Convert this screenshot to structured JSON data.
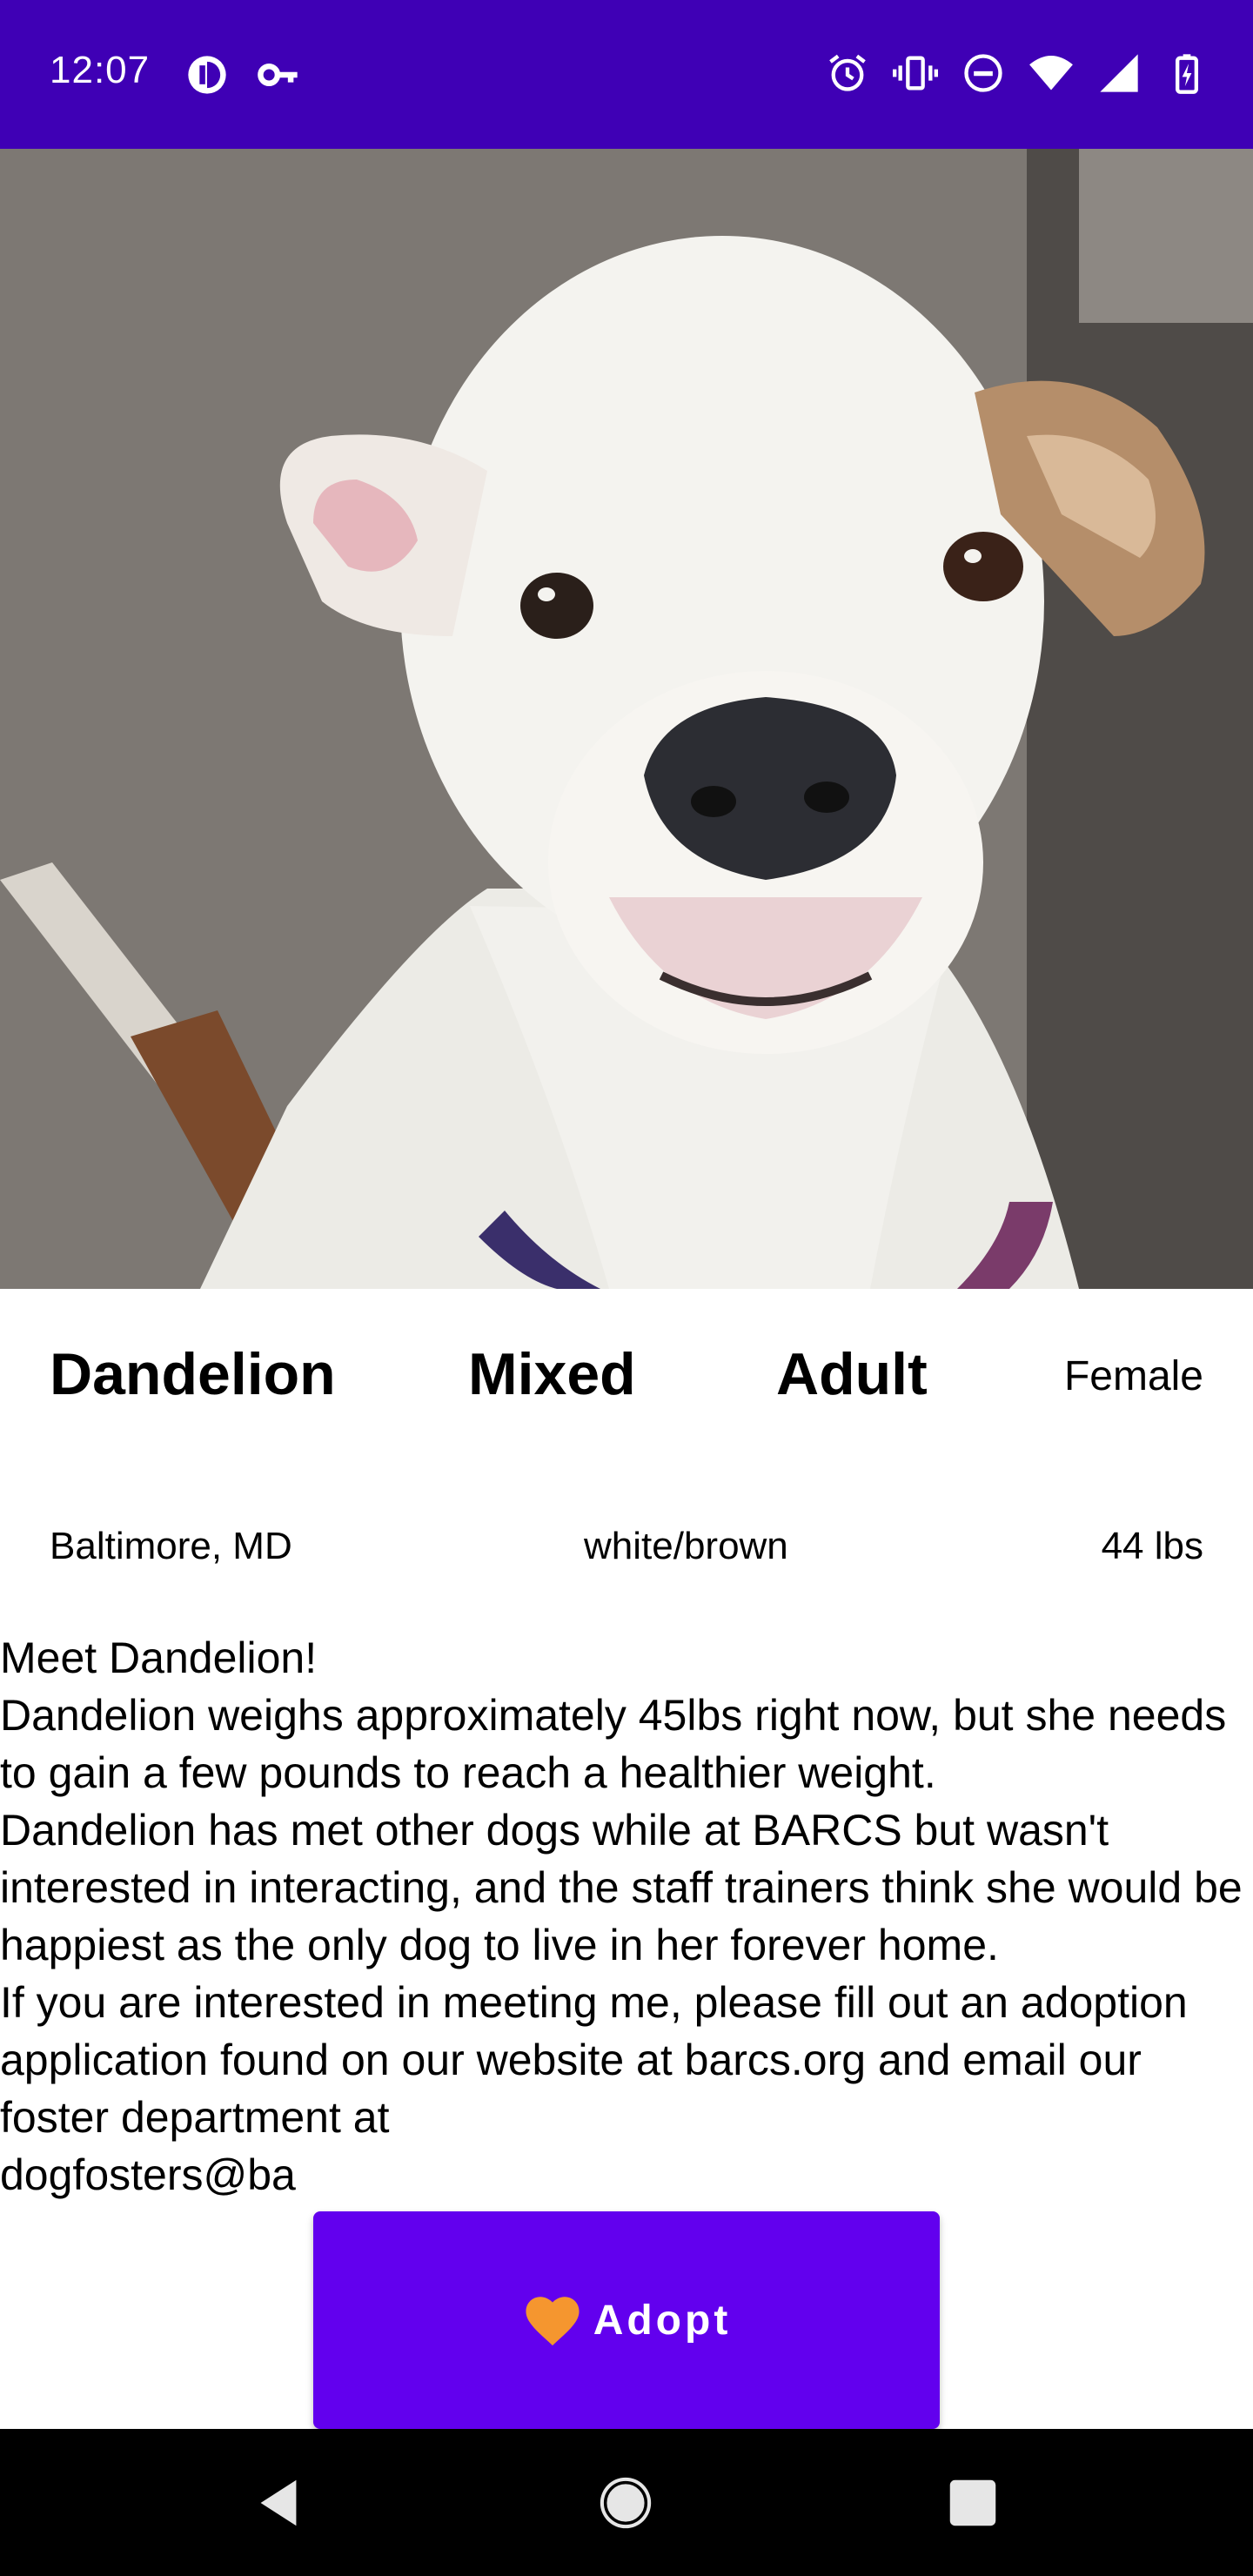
{
  "status_bar": {
    "time": "12:07",
    "icons_left": [
      "data-saver-icon",
      "vpn-key-icon"
    ],
    "icons_right": [
      "alarm-icon",
      "vibrate-icon",
      "do-not-disturb-icon",
      "wifi-icon",
      "cell-signal-icon",
      "battery-charging-icon"
    ]
  },
  "hero": {
    "image": "dog-photo"
  },
  "pet": {
    "name": "Dandelion",
    "breed": "Mixed",
    "age": "Adult",
    "gender": "Female",
    "location": "Baltimore, MD",
    "color": "white/brown",
    "weight": "44 lbs"
  },
  "description": "Meet Dandelion!\nDandelion weighs approximately 45lbs right now, but she needs to gain a few pounds to reach a healthier weight.\nDandelion has met other dogs while at BARCS but wasn't interested in interacting, and the staff trainers think she would be happiest as the only dog to live in her forever home.\nIf you are interested in meeting me, please fill out an adoption application found on our website at barcs.org and email our foster department at\ndogfosters@ba",
  "adopt_button": {
    "label": "Adopt",
    "icon": "heart-icon",
    "background": "#6200ee",
    "icon_color": "#f5962f"
  },
  "nav_bar": {
    "buttons": [
      "back-icon",
      "home-icon",
      "recents-icon"
    ]
  },
  "colors": {
    "status_bar": "#3f00b5",
    "primary": "#6200ee"
  }
}
